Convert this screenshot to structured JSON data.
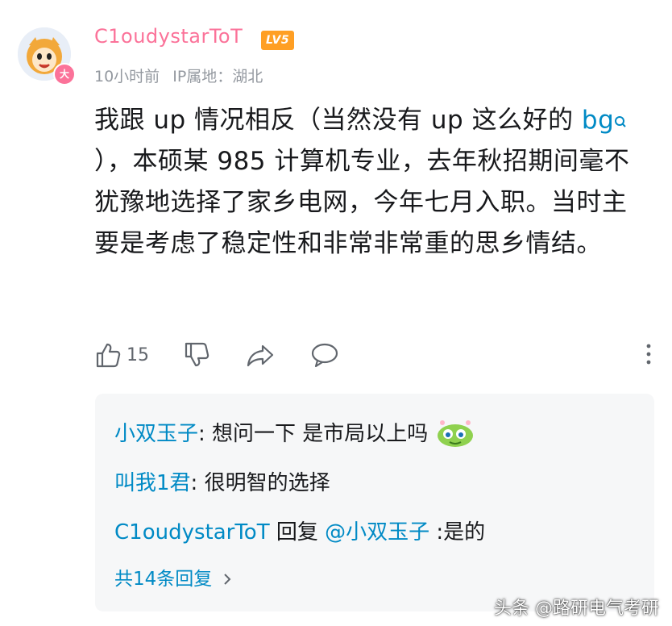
{
  "comment": {
    "username": "C1oudystarToT",
    "level": "LV5",
    "avatar_badge": "大",
    "time": "10小时前",
    "ip_location": "IP属地：湖北",
    "text_part1": "我跟 up 情况相反（当然没有 up 这么好的 ",
    "text_link": "bg",
    "text_part2": "），本硕某 985 计算机专业，去年秋招期间毫不犹豫地选择了家乡电网，今年七月入职。当时主要是考虑了稳定性和非常非常重的思乡情结。",
    "likes": "15"
  },
  "icons": {
    "like": "thumbs-up-icon",
    "dislike": "thumbs-down-icon",
    "share": "share-icon",
    "reply": "comment-icon",
    "more": "more-vertical-icon",
    "search": "search-icon",
    "emoji": "emoji-icon"
  },
  "replies": [
    {
      "name": "小双玉子",
      "separator": ":",
      "text": " 想问一下 是市局以上吗"
    },
    {
      "name": "叫我1君",
      "separator": ":",
      "text": " 很明智的选择"
    },
    {
      "name": "C1oudystarToT",
      "middle": " 回复 ",
      "mention": "@小双玉子",
      "separator": " :",
      "text": "是的"
    }
  ],
  "total_replies": "共14条回复",
  "watermark": "头条 @路研电气考研",
  "colors": {
    "username": "#fb7299",
    "link": "#008ac5",
    "meta": "#9499a0",
    "level": "#ff9f24"
  }
}
